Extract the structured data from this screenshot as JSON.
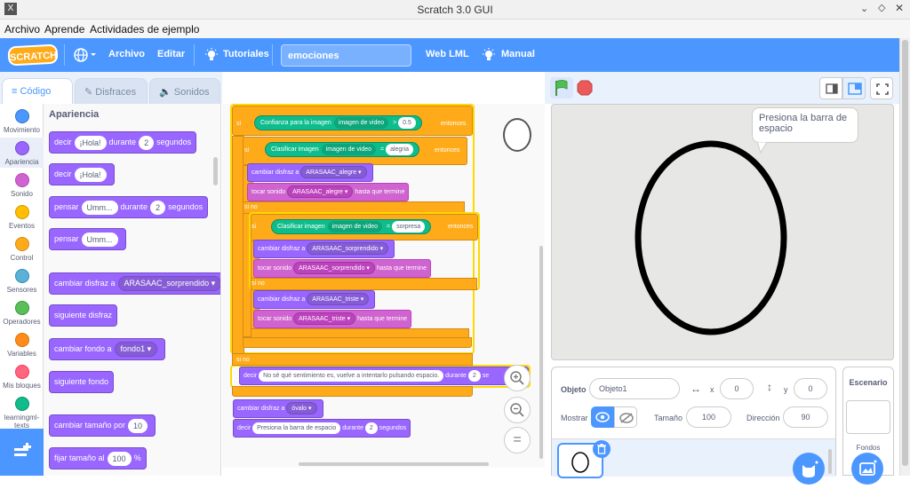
{
  "window": {
    "title": "Scratch 3.0 GUI",
    "app_icon": "x-app-icon"
  },
  "menubar": {
    "items": [
      "Archivo",
      "Aprende",
      "Actividades de ejemplo"
    ]
  },
  "appbar": {
    "logo": "SCRATCH",
    "archivo": "Archivo",
    "editar": "Editar",
    "tutoriales": "Tutoriales",
    "project_title": "emociones",
    "web_lml": "Web LML",
    "manual": "Manual"
  },
  "tabs": {
    "code": "Código",
    "costumes": "Disfraces",
    "sounds": "Sonidos"
  },
  "categories": [
    {
      "label": "Movimiento",
      "color": "#4c97ff"
    },
    {
      "label": "Apariencia",
      "color": "#9966ff"
    },
    {
      "label": "Sonido",
      "color": "#cf63cf"
    },
    {
      "label": "Eventos",
      "color": "#ffbf00"
    },
    {
      "label": "Control",
      "color": "#ffab19"
    },
    {
      "label": "Sensores",
      "color": "#5cb1d6"
    },
    {
      "label": "Operadores",
      "color": "#59c059"
    },
    {
      "label": "Variables",
      "color": "#ff8c1a"
    },
    {
      "label": "Mis bloques",
      "color": "#ff6680"
    },
    {
      "label": "learningml-texts",
      "color": "#0fbd8c"
    }
  ],
  "palette": {
    "heading": "Apariencia",
    "decir_for": {
      "pre": "decir",
      "msg": "¡Hola!",
      "mid": "durante",
      "num": "2",
      "post": "segundos"
    },
    "decir": {
      "pre": "decir",
      "msg": "¡Hola!"
    },
    "pensar_for": {
      "pre": "pensar",
      "msg": "Umm...",
      "mid": "durante",
      "num": "2",
      "post": "segundos"
    },
    "pensar": {
      "pre": "pensar",
      "msg": "Umm..."
    },
    "cambiar_disfraz": {
      "pre": "cambiar disfraz a",
      "value": "ARASAAC_sorprendido"
    },
    "siguiente_disfraz": "siguiente disfraz",
    "cambiar_fondo": {
      "pre": "cambiar fondo a",
      "value": "fondo1"
    },
    "siguiente_fondo": "siguiente fondo",
    "cambiar_tamano": {
      "pre": "cambiar tamaño por",
      "num": "10"
    },
    "fijar_tamano": {
      "pre": "fijar tamaño al",
      "num": "100",
      "post": "%"
    }
  },
  "script": {
    "si": "si",
    "entonces": "entonces",
    "si_no": "si no",
    "cond1": {
      "label": "Confianza para la imagen",
      "input": "imagen de video",
      "op": ">",
      "value": "0.5"
    },
    "cond2": {
      "label": "Clasificar imagen",
      "input": "imagen de video",
      "op": "=",
      "value": "alegria"
    },
    "cond3": {
      "label": "Clasificar imagen",
      "input": "imagen de video",
      "op": "=",
      "value": "sorpresa"
    },
    "cambiar_disfraz_a": "cambiar disfraz a",
    "tocar_sonido": "tocar sonido",
    "hasta_que_termine": "hasta que termine",
    "alegre_costume": "ARASAAC_alegre",
    "alegre_sound": "ARASAAC_alegre",
    "sorprendido_costume": "ARASAAC_sorprendido",
    "sorprendido_sound": "ARASAAC_sorprendido",
    "triste_costume": "ARASAAC_triste",
    "triste_sound": "ARASAAC_triste",
    "decir": "decir",
    "decir_msg": "No sé qué sentimiento es, vuelve a intentarlo pulsando espacio.",
    "durante": "durante",
    "num2": "2",
    "segundos_short": "se",
    "segundos": "segundos",
    "ovalo": "óvalo",
    "barra_msg": "Presiona la barra de espacio"
  },
  "stage": {
    "speech": "Presiona la barra de espacio"
  },
  "sprite": {
    "objeto_label": "Objeto",
    "objeto_value": "Objeto1",
    "x_label": "x",
    "x_value": "0",
    "y_label": "y",
    "y_value": "0",
    "mostrar_label": "Mostrar",
    "tamano_label": "Tamaño",
    "tamano_value": "100",
    "direccion_label": "Dirección",
    "direccion_value": "90"
  },
  "backdrop": {
    "title": "Escenario",
    "fondos": "Fondos"
  }
}
